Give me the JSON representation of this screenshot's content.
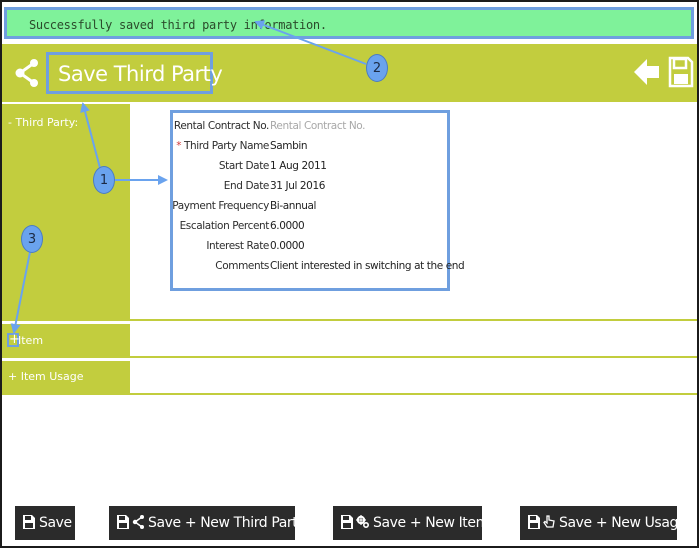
{
  "notification": {
    "message": "Successfully saved third party information."
  },
  "header": {
    "title": "Save Third Party",
    "share_icon": "share-icon",
    "back_icon": "back-arrow-icon",
    "save_icon": "floppy-disk-icon"
  },
  "sections": {
    "third_party": {
      "label": "- Third Party:"
    },
    "item": {
      "label": "Item",
      "expander": "+"
    },
    "item_usage": {
      "label": "+ Item Usage"
    }
  },
  "details": {
    "rows": [
      {
        "label": "Rental Contract No.",
        "value": "Rental Contract No.",
        "placeholder": true,
        "required": false
      },
      {
        "label": "Third Party Name",
        "value": "Sambin",
        "placeholder": false,
        "required": true
      },
      {
        "label": "Start Date",
        "value": "1 Aug 2011",
        "placeholder": false,
        "required": false
      },
      {
        "label": "End Date",
        "value": "31 Jul 2016",
        "placeholder": false,
        "required": false
      },
      {
        "label": "Payment Frequency",
        "value": "Bi-annual",
        "placeholder": false,
        "required": false
      },
      {
        "label": "Escalation Percent",
        "value": "6.0000",
        "placeholder": false,
        "required": false
      },
      {
        "label": "Interest Rate",
        "value": "0.0000",
        "placeholder": false,
        "required": false
      },
      {
        "label": "Comments",
        "value": "Client interested in switching at the end",
        "placeholder": false,
        "required": false
      }
    ],
    "required_marker": "*"
  },
  "annotations": [
    "1",
    "2",
    "3"
  ],
  "buttons": {
    "save": "Save",
    "save_new_third_party": "Save + New Third Party",
    "save_new_item": "Save + New Item",
    "save_new_usage": "Save + New Usage"
  },
  "colors": {
    "accent": "#c2cd3e",
    "success": "#7ff29a",
    "callout": "#6f9fdf",
    "button": "#2b2b2b"
  }
}
